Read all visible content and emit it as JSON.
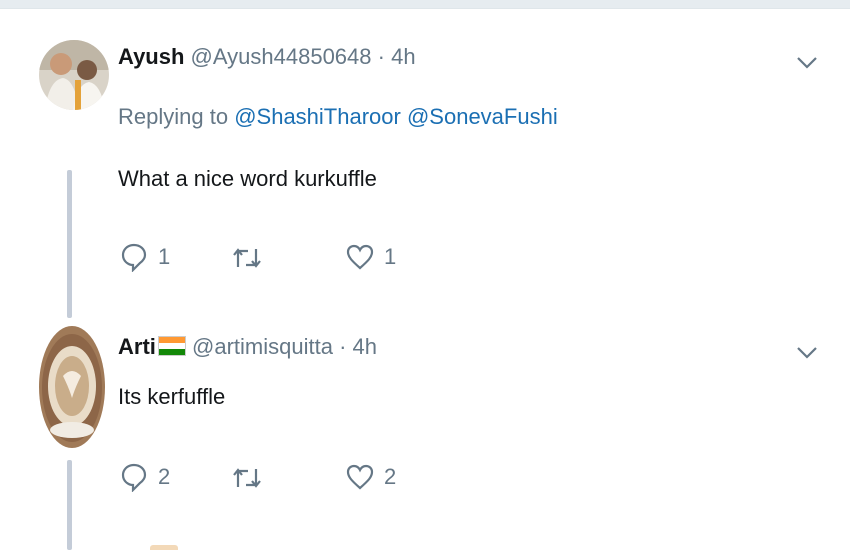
{
  "tweets": [
    {
      "name": "Ayush",
      "handle": "@Ayush44850648",
      "dot": "·",
      "time": "4h",
      "replying_prefix": "Replying to",
      "mentions": [
        "@ShashiTharoor",
        "@SonevaFushi"
      ],
      "text": "What a nice word kurkuffle",
      "reply_count": "1",
      "retweet_count": "",
      "like_count": "1"
    },
    {
      "name": "Arti",
      "flag": "india-flag",
      "handle": "@artimisquitta",
      "dot": "·",
      "time": "4h",
      "text": "Its kerfuffle",
      "reply_count": "2",
      "retweet_count": "",
      "like_count": "2"
    }
  ],
  "icons": {
    "reply": "reply-icon",
    "retweet": "retweet-icon",
    "like": "heart-icon",
    "caret": "chevron-down-icon"
  },
  "colors": {
    "mention": "#1b6fb3",
    "muted": "#657786",
    "thread_line": "#c4ccd8",
    "flag_saffron": "#ff9933",
    "flag_green": "#138808"
  }
}
